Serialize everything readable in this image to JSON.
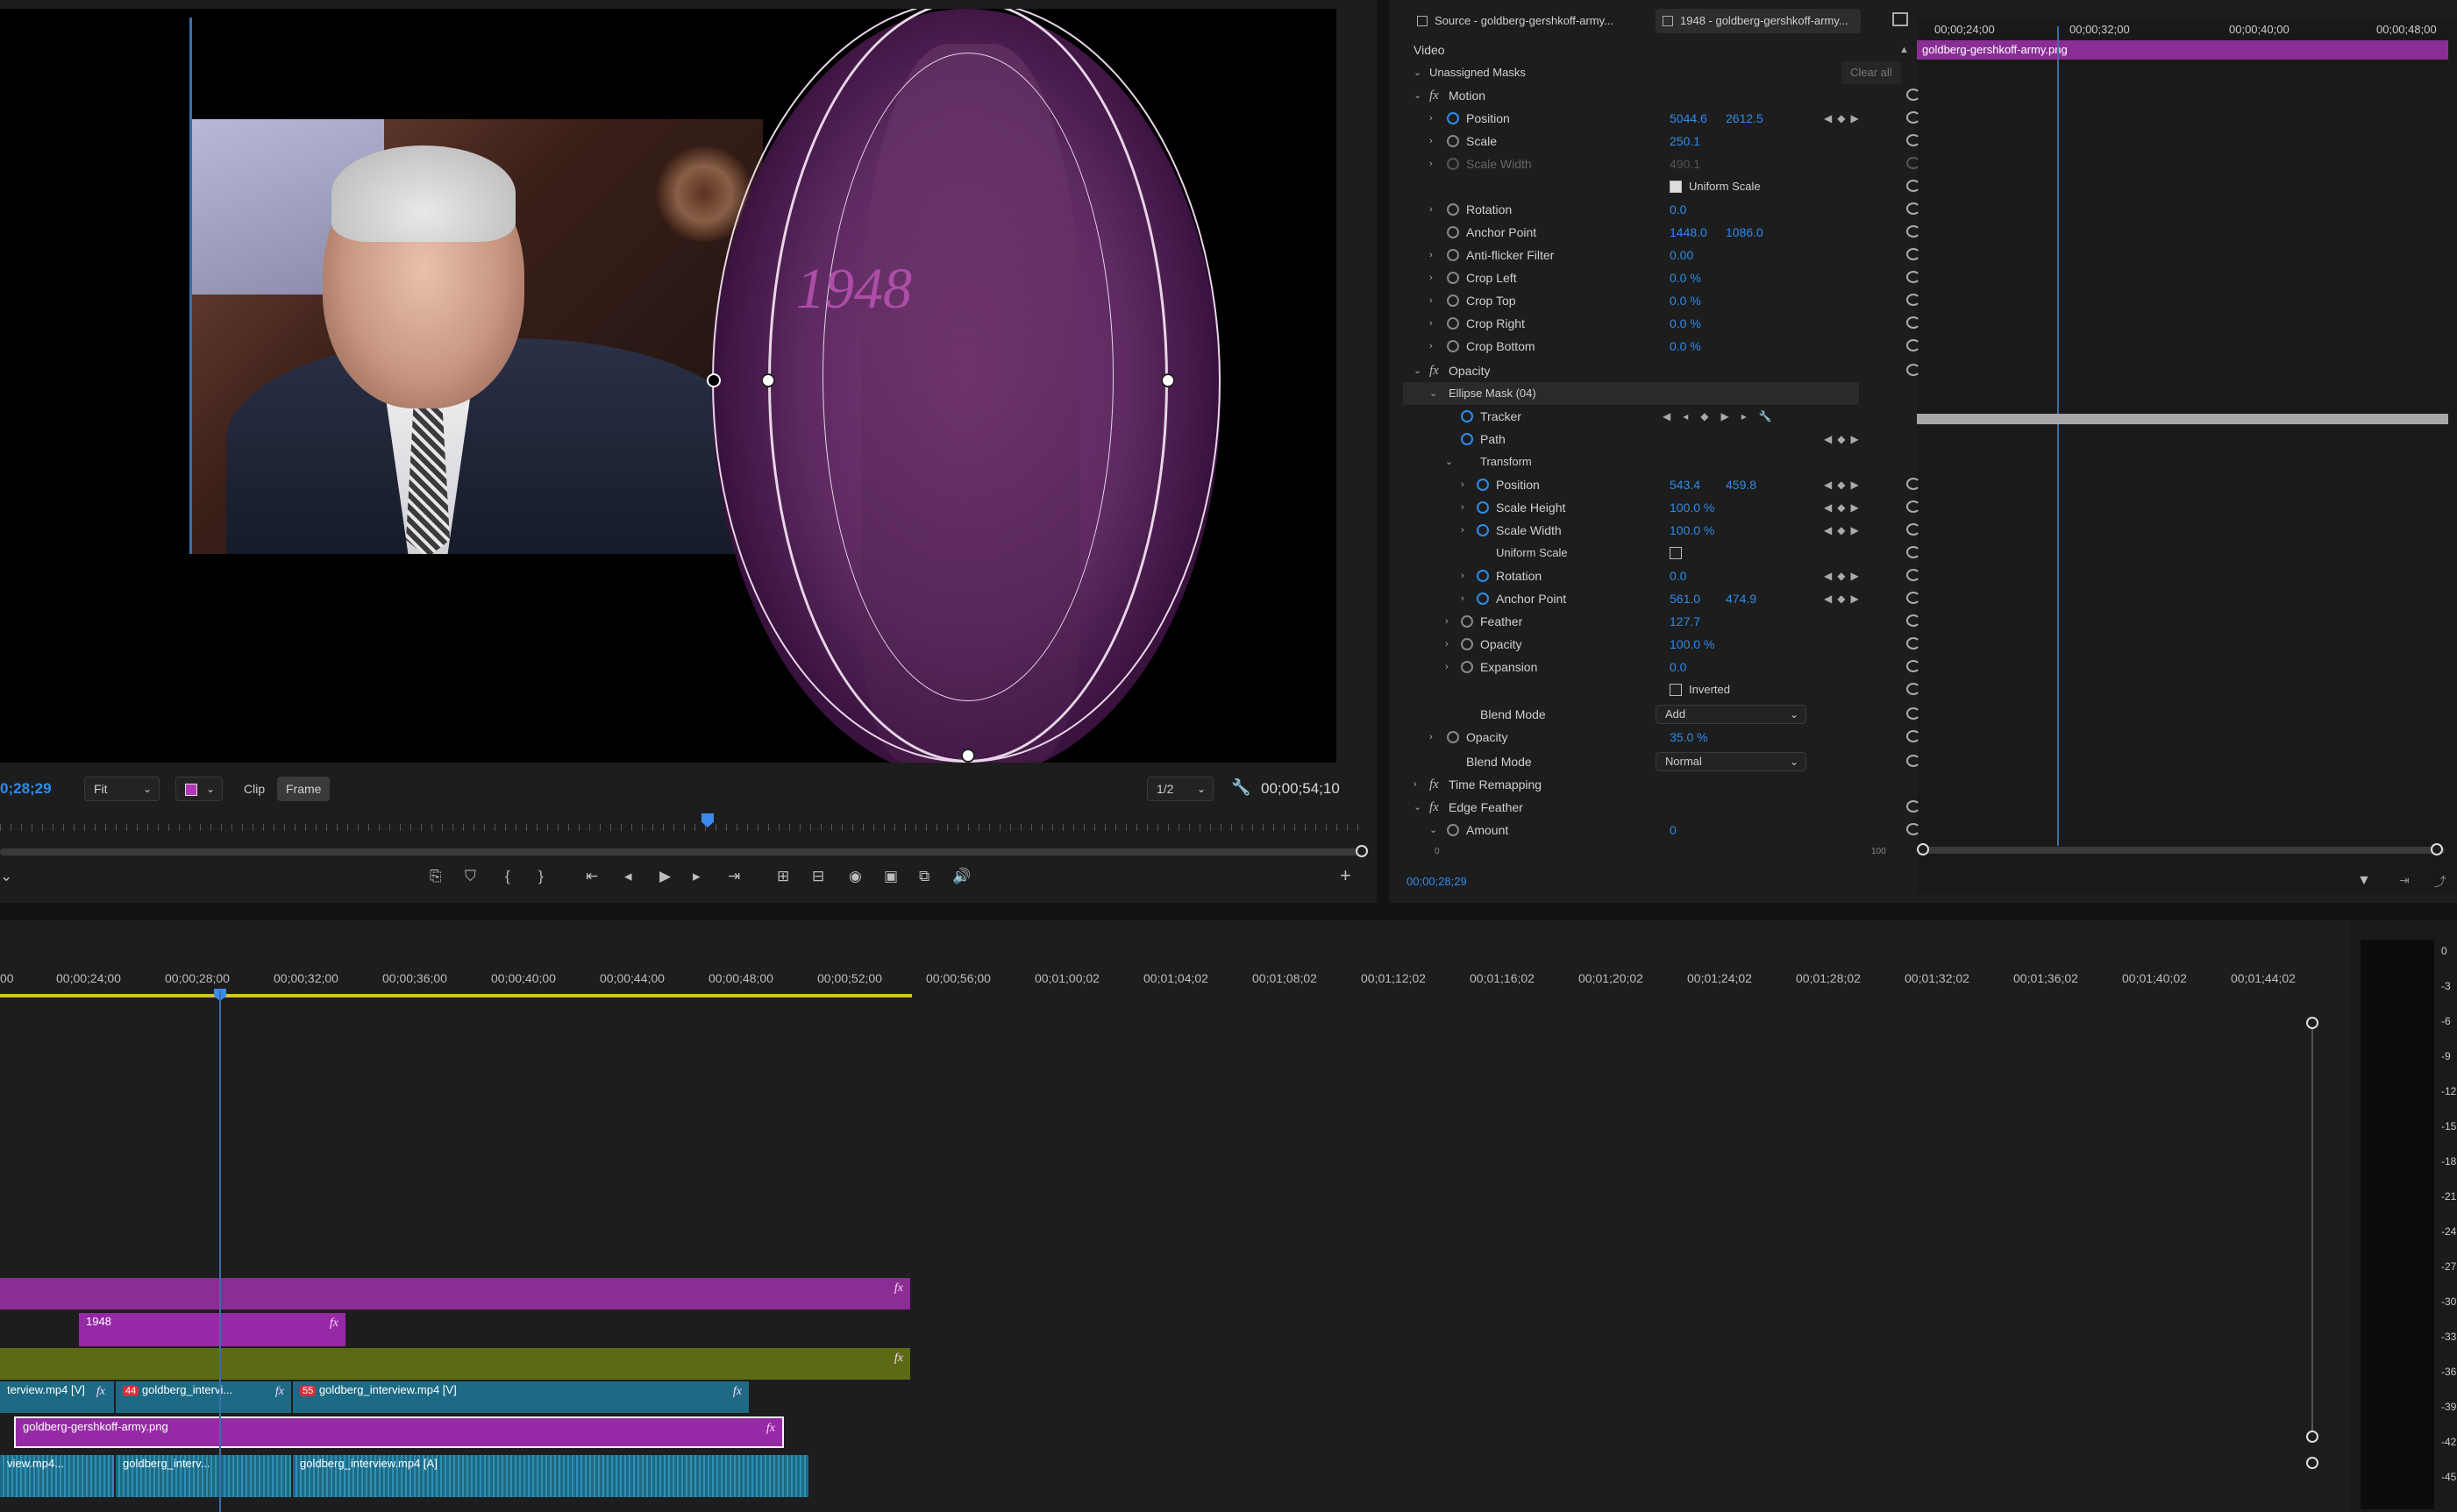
{
  "program": {
    "timecode_current": "0;28;29",
    "timecode_duration": "00;00;54;10",
    "fit_option": "Fit",
    "clip_label": "Clip",
    "frame_label": "Frame",
    "resolution_option": "1/2",
    "overlay_title": "1948"
  },
  "effect_controls": {
    "tab_source": "Source - goldberg-gershkoff-army...",
    "tab_sequence": "1948 - goldberg-gershkoff-army...",
    "section_video": "Video",
    "unassigned_masks": "Unassigned Masks",
    "clear_all": "Clear all",
    "motion": {
      "label": "Motion",
      "position_label": "Position",
      "position_x": "5044.6",
      "position_y": "2612.5",
      "scale_label": "Scale",
      "scale": "250.1",
      "scale_width_label": "Scale Width",
      "scale_width": "490.1",
      "uniform_scale_label": "Uniform Scale",
      "rotation_label": "Rotation",
      "rotation": "0.0",
      "anchor_label": "Anchor Point",
      "anchor_x": "1448.0",
      "anchor_y": "1086.0",
      "antiflicker_label": "Anti-flicker Filter",
      "antiflicker": "0.00",
      "crop_left_label": "Crop Left",
      "crop_left": "0.0 %",
      "crop_top_label": "Crop Top",
      "crop_top": "0.0 %",
      "crop_right_label": "Crop Right",
      "crop_right": "0.0 %",
      "crop_bottom_label": "Crop Bottom",
      "crop_bottom": "0.0 %"
    },
    "opacity": {
      "label": "Opacity",
      "mask_label": "Ellipse Mask (04)",
      "tracker_label": "Tracker",
      "path_label": "Path",
      "transform_label": "Transform",
      "t_position_label": "Position",
      "t_position_x": "543.4",
      "t_position_y": "459.8",
      "t_scale_height_label": "Scale Height",
      "t_scale_height": "100.0 %",
      "t_scale_width_label": "Scale Width",
      "t_scale_width": "100.0 %",
      "t_uniform_label": "Uniform Scale",
      "t_rotation_label": "Rotation",
      "t_rotation": "0.0",
      "t_anchor_label": "Anchor Point",
      "t_anchor_x": "561.0",
      "t_anchor_y": "474.9",
      "feather_label": "Feather",
      "feather": "127.7",
      "mask_opacity_label": "Opacity",
      "mask_opacity": "100.0 %",
      "expansion_label": "Expansion",
      "expansion": "0.0",
      "inverted_label": "Inverted",
      "mask_blend_label": "Blend Mode",
      "mask_blend": "Add",
      "opacity_label": "Opacity",
      "opacity_value": "35.0 %",
      "blend_label": "Blend Mode",
      "blend": "Normal"
    },
    "time_remapping": "Time Remapping",
    "edge_feather": "Edge Feather",
    "amount_label": "Amount",
    "amount": "0",
    "slider_min": "0",
    "slider_max": "100",
    "footer_timecode": "00;00;28;29",
    "ruler": [
      "00;00;24;00",
      "00;00;32;00",
      "00;00;40;00",
      "00;00;48;00"
    ],
    "clip_name": "goldberg-gershkoff-army.png"
  },
  "timeline": {
    "ruler": [
      "00",
      "00;00;24;00",
      "00;00;28;00",
      "00;00;32;00",
      "00;00;36;00",
      "00;00;40;00",
      "00;00;44;00",
      "00;00;48;00",
      "00;00;52;00",
      "00;00;56;00",
      "00;01;00;02",
      "00;01;04;02",
      "00;01;08;02",
      "00;01;12;02",
      "00;01;16;02",
      "00;01;20;02",
      "00;01;24;02",
      "00;01;28;02",
      "00;01;32;02",
      "00;01;36;02",
      "00;01;40;02",
      "00;01;44;02"
    ],
    "clip_1948": "1948",
    "clip_v1a": "terview.mp4 [V]",
    "clip_v1b": "goldberg_intervi...",
    "clip_v1c": "goldberg_interview.mp4 [V]",
    "badge_1": "44",
    "badge_2": "55",
    "clip_png": "goldberg-gershkoff-army.png",
    "clip_a1a": "view.mp4...",
    "clip_a1b": "goldberg_interv...",
    "clip_a1c": "goldberg_interview.mp4 [A]",
    "fx": "fx"
  },
  "meter": [
    "0",
    "-3",
    "-6",
    "-9",
    "-12",
    "-15",
    "-18",
    "-21",
    "-24",
    "-27",
    "-30",
    "-33",
    "-36",
    "-39",
    "-42",
    "-45"
  ]
}
